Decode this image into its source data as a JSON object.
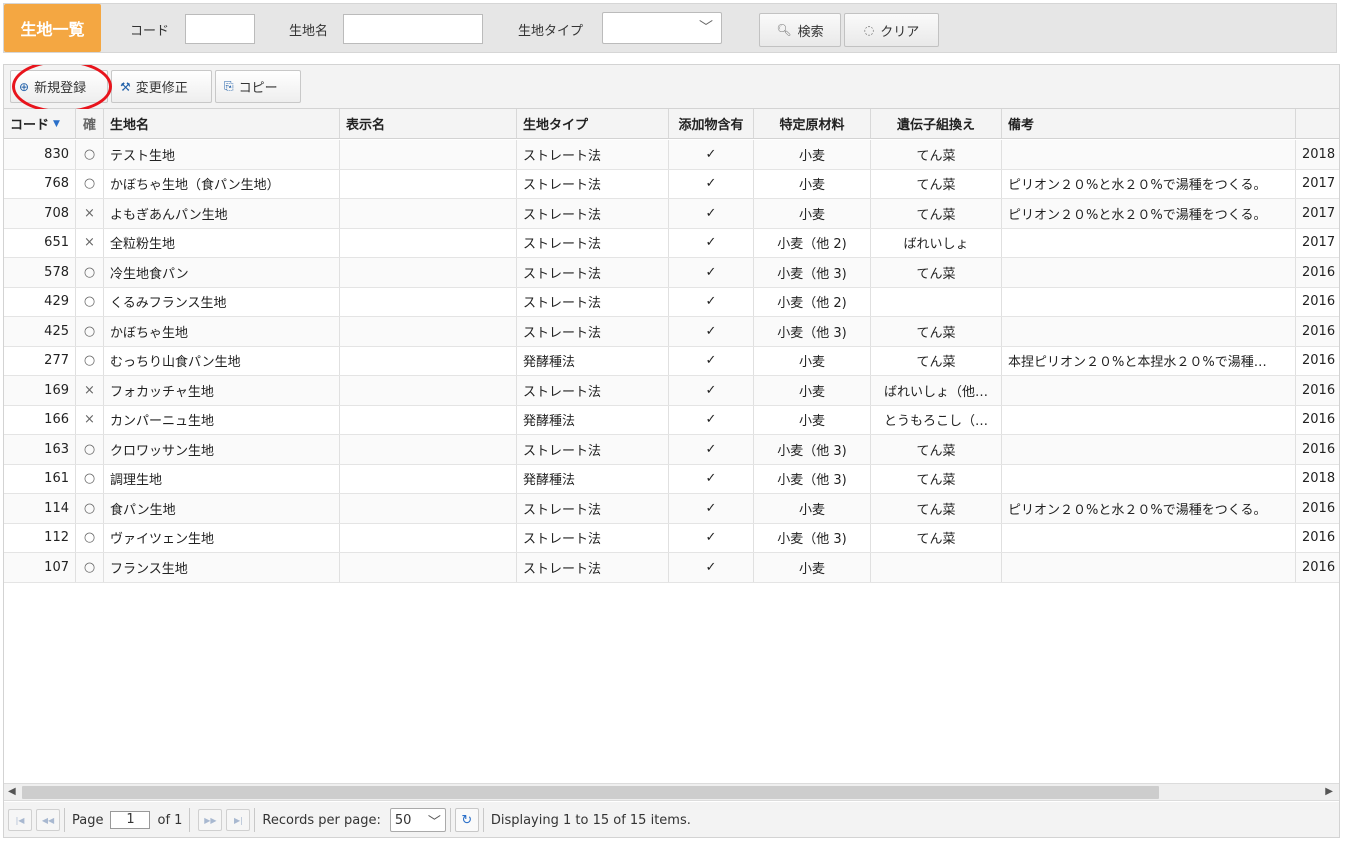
{
  "search": {
    "title": "生地一覧",
    "code_label": "コード",
    "name_label": "生地名",
    "type_label": "生地タイプ",
    "type_value": "",
    "search_button": "検索",
    "clear_button": "クリア"
  },
  "toolbar": {
    "new_button": "新規登録",
    "edit_button": "変更修正",
    "copy_button": "コピー"
  },
  "grid": {
    "headers": {
      "code": "コード",
      "kaku": "確",
      "name": "生地名",
      "display": "表示名",
      "type": "生地タイプ",
      "additive": "添加物含有",
      "special": "特定原材料",
      "gene": "遺伝子組換え",
      "note": "備考",
      "date": ""
    },
    "rows": [
      {
        "code": "830",
        "kaku": "○",
        "name": "テスト生地",
        "display": "",
        "type": "ストレート法",
        "additive": "✓",
        "special": "小麦",
        "gene": "てん菜",
        "note": "",
        "date": "2018"
      },
      {
        "code": "768",
        "kaku": "○",
        "name": "かぼちゃ生地（食パン生地）",
        "display": "",
        "type": "ストレート法",
        "additive": "✓",
        "special": "小麦",
        "gene": "てん菜",
        "note": "ピリオン２０%と水２０%で湯種をつくる。",
        "date": "2017"
      },
      {
        "code": "708",
        "kaku": "×",
        "name": "よもぎあんパン生地",
        "display": "",
        "type": "ストレート法",
        "additive": "✓",
        "special": "小麦",
        "gene": "てん菜",
        "note": "ピリオン２０%と水２０%で湯種をつくる。",
        "date": "2017"
      },
      {
        "code": "651",
        "kaku": "×",
        "name": "全粒粉生地",
        "display": "",
        "type": "ストレート法",
        "additive": "✓",
        "special": "小麦（他 2)",
        "gene": "ばれいしょ",
        "note": "",
        "date": "2017"
      },
      {
        "code": "578",
        "kaku": "○",
        "name": "冷生地食パン",
        "display": "",
        "type": "ストレート法",
        "additive": "✓",
        "special": "小麦（他 3)",
        "gene": "てん菜",
        "note": "",
        "date": "2016"
      },
      {
        "code": "429",
        "kaku": "○",
        "name": "くるみフランス生地",
        "display": "",
        "type": "ストレート法",
        "additive": "✓",
        "special": "小麦（他 2)",
        "gene": "",
        "note": "",
        "date": "2016"
      },
      {
        "code": "425",
        "kaku": "○",
        "name": "かぼちゃ生地",
        "display": "",
        "type": "ストレート法",
        "additive": "✓",
        "special": "小麦（他 3)",
        "gene": "てん菜",
        "note": "",
        "date": "2016"
      },
      {
        "code": "277",
        "kaku": "○",
        "name": "むっちり山食パン生地",
        "display": "",
        "type": "発酵種法",
        "additive": "✓",
        "special": "小麦",
        "gene": "てん菜",
        "note": "本捏ピリオン２０%と本捏水２０%で湯種…",
        "date": "2016"
      },
      {
        "code": "169",
        "kaku": "×",
        "name": "フォカッチャ生地",
        "display": "",
        "type": "ストレート法",
        "additive": "✓",
        "special": "小麦",
        "gene": "ばれいしょ（他…",
        "note": "",
        "date": "2016"
      },
      {
        "code": "166",
        "kaku": "×",
        "name": "カンパーニュ生地",
        "display": "",
        "type": "発酵種法",
        "additive": "✓",
        "special": "小麦",
        "gene": "とうもろこし（…",
        "note": "",
        "date": "2016"
      },
      {
        "code": "163",
        "kaku": "○",
        "name": "クロワッサン生地",
        "display": "",
        "type": "ストレート法",
        "additive": "✓",
        "special": "小麦（他 3)",
        "gene": "てん菜",
        "note": "",
        "date": "2016"
      },
      {
        "code": "161",
        "kaku": "○",
        "name": "調理生地",
        "display": "",
        "type": "発酵種法",
        "additive": "✓",
        "special": "小麦（他 3)",
        "gene": "てん菜",
        "note": "",
        "date": "2018"
      },
      {
        "code": "114",
        "kaku": "○",
        "name": "食パン生地",
        "display": "",
        "type": "ストレート法",
        "additive": "✓",
        "special": "小麦",
        "gene": "てん菜",
        "note": "ピリオン２０%と水２０%で湯種をつくる。",
        "date": "2016"
      },
      {
        "code": "112",
        "kaku": "○",
        "name": "ヴァイツェン生地",
        "display": "",
        "type": "ストレート法",
        "additive": "✓",
        "special": "小麦（他 3)",
        "gene": "てん菜",
        "note": "",
        "date": "2016"
      },
      {
        "code": "107",
        "kaku": "○",
        "name": "フランス生地",
        "display": "",
        "type": "ストレート法",
        "additive": "✓",
        "special": "小麦",
        "gene": "",
        "note": "",
        "date": "2016"
      }
    ]
  },
  "pager": {
    "page_label": "Page",
    "page_value": "1",
    "of_label": "of 1",
    "rpp_label": "Records per page:",
    "rpp_value": "50",
    "display_text": "Displaying 1 to 15 of 15 items."
  },
  "colors": {
    "title_bg": "#f4a742",
    "highlight_circle": "#e8141c",
    "sort_arrow": "#2a6fc9"
  }
}
